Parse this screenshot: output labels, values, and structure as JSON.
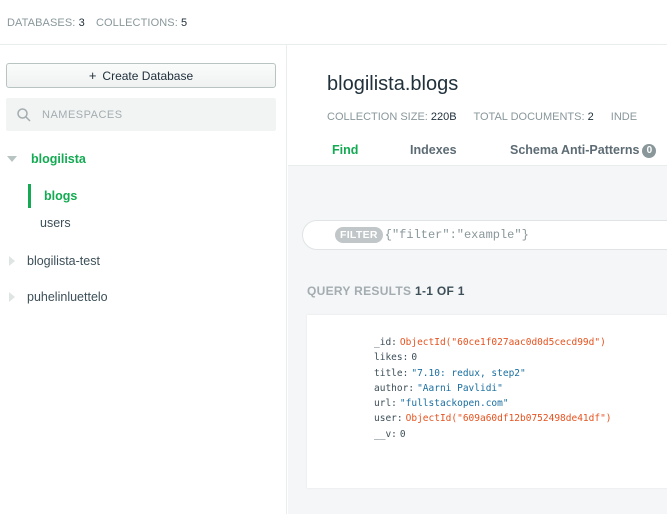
{
  "topbar": {
    "databases_label": "DATABASES:",
    "databases_count": "3",
    "collections_label": "COLLECTIONS:",
    "collections_count": "5"
  },
  "sidebar": {
    "create_database_label": "Create Database",
    "search_placeholder": "NAMESPACES",
    "databases": [
      {
        "name": "blogilista",
        "expanded": true,
        "collections": [
          "blogs",
          "users"
        ],
        "active_collection": "blogs"
      },
      {
        "name": "blogilista-test",
        "expanded": false
      },
      {
        "name": "puhelinluettelo",
        "expanded": false
      }
    ]
  },
  "collection": {
    "title": "blogilista.blogs",
    "size_label": "COLLECTION SIZE:",
    "size_value": "220B",
    "docs_label": "TOTAL DOCUMENTS:",
    "docs_value": "2",
    "index_label_partial": "INDE"
  },
  "tabs": [
    {
      "label": "Find",
      "active": true
    },
    {
      "label": "Indexes",
      "active": false
    },
    {
      "label": "Schema Anti-Patterns",
      "badge": "0",
      "active": false
    }
  ],
  "filter": {
    "pill": "FILTER",
    "placeholder": "{\"filter\":\"example\"}"
  },
  "query_results": {
    "label": "QUERY RESULTS",
    "count": "1-1 OF 1"
  },
  "document": [
    {
      "key": "_id",
      "value": "ObjectId(\"60ce1f027aac0d0d5cecd99d\")",
      "type": "oid"
    },
    {
      "key": "likes",
      "value": "0",
      "type": "num"
    },
    {
      "key": "title",
      "value": "\"7.10: redux, step2\"",
      "type": "str"
    },
    {
      "key": "author",
      "value": "\"Aarni Pavlidi\"",
      "type": "str"
    },
    {
      "key": "url",
      "value": "\"fullstackopen.com\"",
      "type": "str"
    },
    {
      "key": "user",
      "value": "ObjectId(\"609a60df12b0752498de41df\")",
      "type": "oid"
    },
    {
      "key": "__v",
      "value": "0",
      "type": "num"
    }
  ],
  "colors": {
    "accent_green": "#13aa52",
    "object_id": "#e6521f",
    "string_value": "#1a6fa0"
  }
}
